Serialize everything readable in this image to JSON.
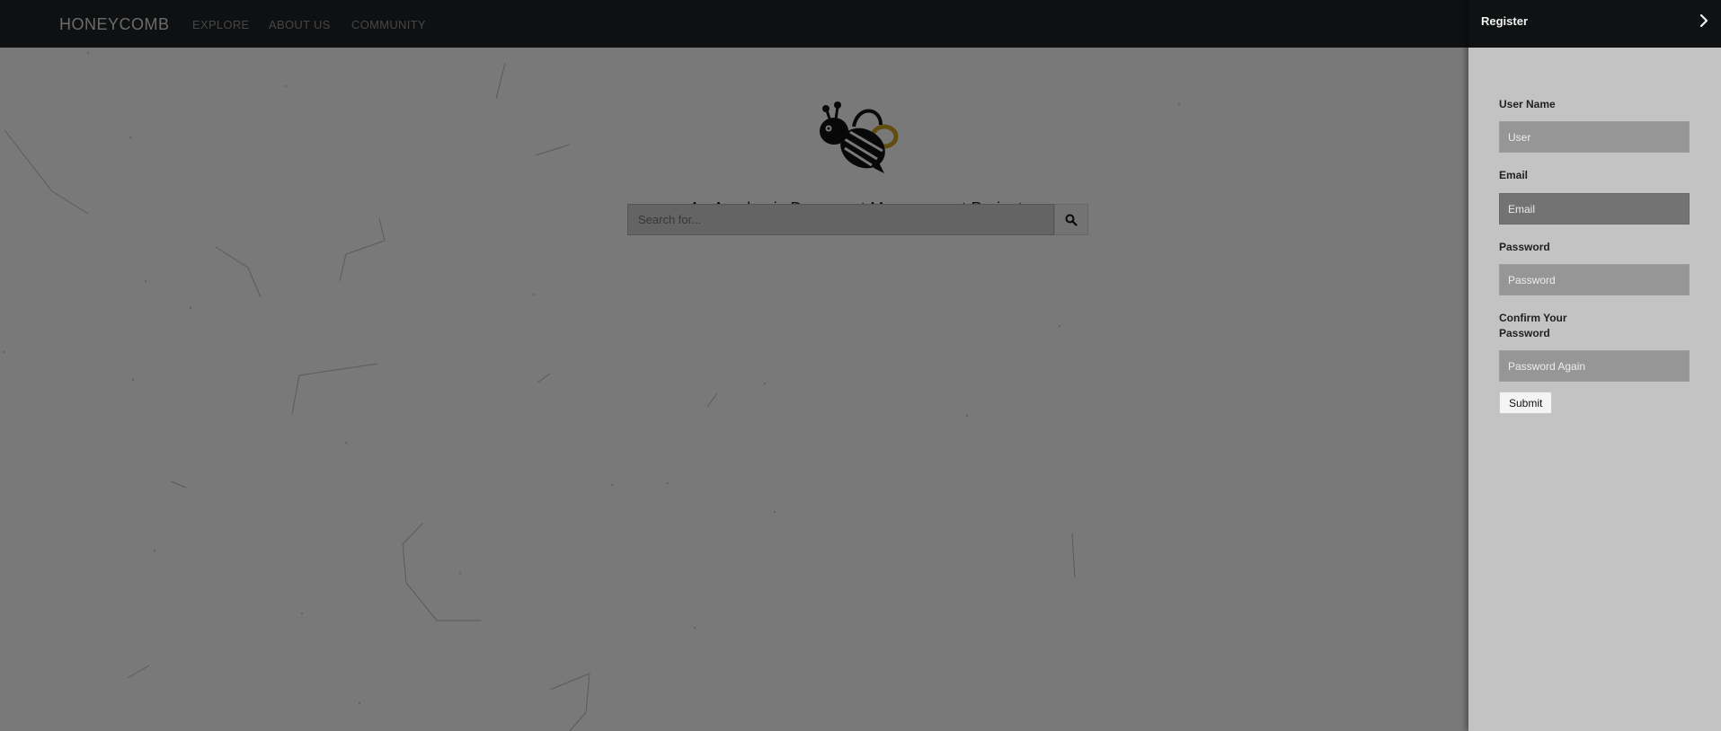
{
  "navbar": {
    "brand": "HONEYCOMB",
    "links": [
      "EXPLORE",
      "ABOUT US",
      "COMMUNITY"
    ]
  },
  "hero": {
    "logo_icon": "bee-icon",
    "tagline": "An Academic Document Management Project.",
    "search_placeholder": "Search for...",
    "search_icon": "search-icon"
  },
  "drawer": {
    "title": "Register",
    "close_icon": "chevron-right-icon",
    "fields": {
      "username_label": "User Name",
      "username_placeholder": "User",
      "email_label": "Email",
      "email_placeholder": "Email",
      "password_label": "Password",
      "password_placeholder": "Password",
      "confirm_label": "Confirm Your Password",
      "confirm_placeholder": "Password Again"
    },
    "submit_label": "Submit"
  },
  "colors": {
    "navbar": "#1e2124",
    "drawer_header": "#0f1113",
    "drawer_body": "#c3c3c3",
    "bee_accent": "#d4a92a"
  }
}
